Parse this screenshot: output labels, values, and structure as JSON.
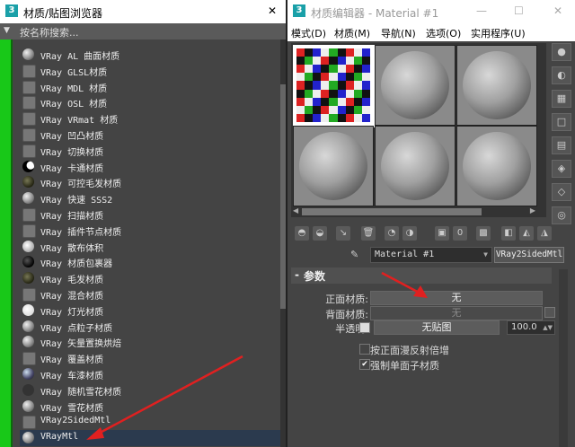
{
  "left_window": {
    "title": "材质/贴图浏览器",
    "close": "✕",
    "search_label": "按名称搜索..."
  },
  "materials": [
    {
      "label": "VRay AL 曲面材质",
      "swatch": "gray"
    },
    {
      "label": "VRay GLSL材质",
      "swatch": "flat"
    },
    {
      "label": "VRay MDL 材质",
      "swatch": "flat"
    },
    {
      "label": "VRay OSL 材质",
      "swatch": "flat"
    },
    {
      "label": "VRay VRmat 材质",
      "swatch": "flat"
    },
    {
      "label": "VRay 凹凸材质",
      "swatch": "flat"
    },
    {
      "label": "VRay 切换材质",
      "swatch": "flat"
    },
    {
      "label": "VRay 卡通材质",
      "swatch": "moon"
    },
    {
      "label": "VRay 可控毛发材质",
      "swatch": "brown"
    },
    {
      "label": "VRay 快速 SSS2",
      "swatch": "gray"
    },
    {
      "label": "VRay 扫描材质",
      "swatch": "flat"
    },
    {
      "label": "VRay 插件节点材质",
      "swatch": "flat"
    },
    {
      "label": "VRay 散布体积",
      "swatch": "light"
    },
    {
      "label": "VRay 材质包裹器",
      "swatch": "dark"
    },
    {
      "label": "VRay 毛发材质",
      "swatch": "brown"
    },
    {
      "label": "VRay 混合材质",
      "swatch": "flat"
    },
    {
      "label": "VRay 灯光材质",
      "swatch": "white"
    },
    {
      "label": "VRay 点粒子材质",
      "swatch": "gray"
    },
    {
      "label": "VRay 矢量置换烘焙",
      "swatch": "gray"
    },
    {
      "label": "VRay 覆盖材质",
      "swatch": "flat"
    },
    {
      "label": "VRay 车漆材质",
      "swatch": "blue"
    },
    {
      "label": "VRay 随机雪花材质",
      "swatch": "dots"
    },
    {
      "label": "VRay 雪花材质",
      "swatch": "gray"
    },
    {
      "label": "VRay2SidedMtl",
      "swatch": "flat"
    },
    {
      "label": "VRayMtl",
      "swatch": "gray",
      "selected": true
    }
  ],
  "right_window": {
    "title": "材质编辑器 - Material #1",
    "minimize": "—",
    "maximize": "☐",
    "close": "✕",
    "menus": [
      "模式(D)",
      "材质(M)",
      "导航(N)",
      "选项(O)",
      "实用程序(U)"
    ]
  },
  "material_name": "Material #1",
  "material_type": "VRay2SidedMtl",
  "rollout": {
    "toggle": "-",
    "title": "参数"
  },
  "params": {
    "front_label": "正面材质:",
    "front_value": "无",
    "back_label": "背面材质:",
    "back_value": "无",
    "translucency_label": "半透明:",
    "translucency_map": "无贴图",
    "translucency_amount": "100.0",
    "option_1": "按正面漫反射倍增",
    "option_1_checked": "",
    "option_2": "强制单面子材质",
    "option_2_checked": "✔"
  },
  "colors": {
    "accent_green": "#18c818",
    "annotation_red": "#e02020",
    "selected_row": "#2b3a4e"
  }
}
